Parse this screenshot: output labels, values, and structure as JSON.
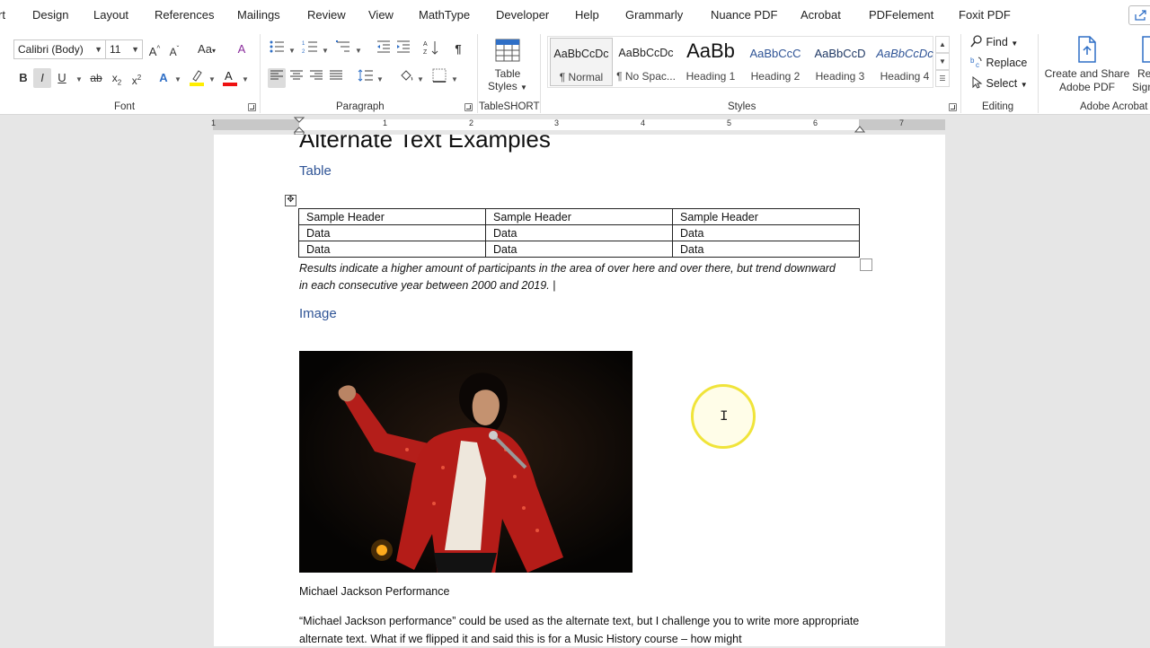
{
  "menu": {
    "items": [
      "rt",
      "Design",
      "Layout",
      "References",
      "Mailings",
      "Review",
      "View",
      "MathType",
      "Developer",
      "Help",
      "Grammarly",
      "Nuance PDF",
      "Acrobat",
      "PDFelement",
      "Foxit PDF"
    ]
  },
  "ribbon": {
    "font": {
      "name": "Calibri (Body)",
      "size": "11",
      "group_label": "Font"
    },
    "paragraph": {
      "group_label": "Paragraph"
    },
    "tableshort": {
      "table_styles_label_1": "Table",
      "table_styles_label_2": "Styles",
      "group_label": "TableSHORT"
    },
    "styles": {
      "group_label": "Styles",
      "items": [
        {
          "preview": "AaBbCcDc",
          "name": "¶ Normal"
        },
        {
          "preview": "AaBbCcDc",
          "name": "¶ No Spac..."
        },
        {
          "preview": "AaBb",
          "name": "Heading 1"
        },
        {
          "preview": "AaBbCcC",
          "name": "Heading 2"
        },
        {
          "preview": "AaBbCcD",
          "name": "Heading 3"
        },
        {
          "preview": "AaBbCcDc",
          "name": "Heading 4"
        }
      ]
    },
    "editing": {
      "find": "Find",
      "replace": "Replace",
      "select": "Select",
      "group_label": "Editing"
    },
    "acrobat": {
      "create_label_1": "Create and Share",
      "create_label_2": "Adobe PDF",
      "request_label_1": "Re",
      "request_label_2": "Sign",
      "group_label": "Adobe Acrobat"
    }
  },
  "ruler": {
    "numbers": [
      "1",
      "1",
      "2",
      "3",
      "4",
      "5",
      "6",
      "7"
    ]
  },
  "document": {
    "title": "Alternate Text Examples",
    "section_table": "Table",
    "table": {
      "headers": [
        "Sample Header",
        "Sample Header",
        "Sample Header"
      ],
      "rows": [
        [
          "Data",
          "Data",
          "Data"
        ],
        [
          "Data",
          "Data",
          "Data"
        ]
      ]
    },
    "table_caption": "Results indicate a higher amount of participants in the area of over here and over there, but trend downward in each consecutive year between 2000 and 2019. |",
    "section_image": "Image",
    "image_caption": "Michael Jackson Performance",
    "paragraph": "“Michael Jackson performance” could be used as the alternate text, but I challenge you to write more appropriate alternate text. What if we flipped it and said this is for a Music History course – how might"
  },
  "colors": {
    "heading_blue": "#2f5496",
    "cursor_highlight": "#f0e43a",
    "acrobat_blue": "#2f6fc6"
  }
}
